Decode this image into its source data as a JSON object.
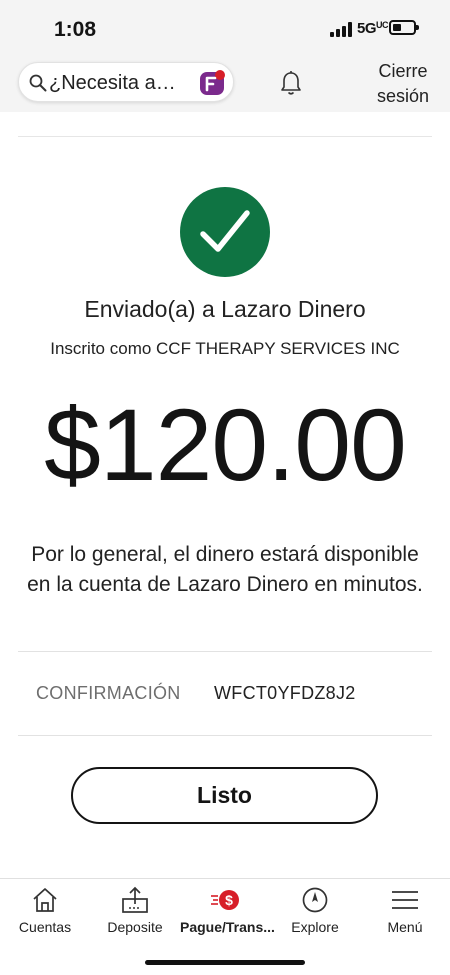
{
  "status_bar": {
    "time": "1:08",
    "network": "5G",
    "network_superscript": "UC"
  },
  "header": {
    "search_placeholder": "¿Necesita a…",
    "signout_line1": "Cierre",
    "signout_line2": "sesión"
  },
  "confirmation": {
    "sent_to": "Enviado(a) a Lazaro Dinero",
    "enrolled_as": "Inscrito como CCF THERAPY SERVICES INC",
    "amount": "$120.00",
    "note": "Por lo general, el dinero estará disponible en la cuenta de Lazaro Dinero en minutos.",
    "label": "CONFIRMACIÓN",
    "code": "WFCT0YFDZ8J2",
    "done": "Listo"
  },
  "tabs": [
    {
      "label": "Cuentas",
      "icon": "home-icon"
    },
    {
      "label": "Deposite",
      "icon": "deposit-icon"
    },
    {
      "label": "Pague/Trans...",
      "icon": "pay-transfer-icon"
    },
    {
      "label": "Explore",
      "icon": "compass-icon"
    },
    {
      "label": "Menú",
      "icon": "menu-icon"
    }
  ],
  "colors": {
    "success": "#0f7443",
    "brand_red": "#d71e28",
    "assistant_purple": "#7b2a8c",
    "header_bg": "#f4f4f4"
  }
}
